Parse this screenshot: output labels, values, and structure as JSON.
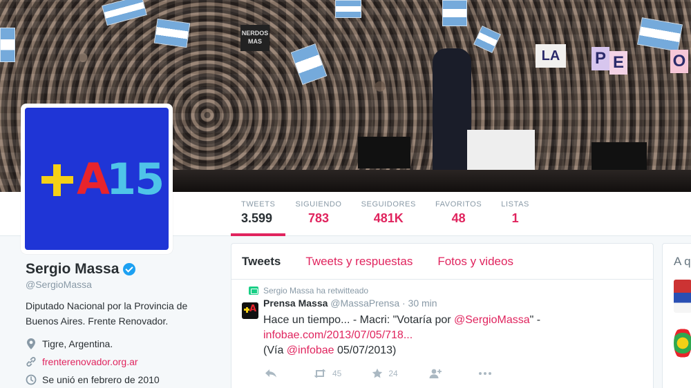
{
  "header": {
    "banner_sign": "NERDOS MAS",
    "banner_letters": [
      "LA",
      "P",
      "E",
      "O"
    ]
  },
  "avatar": {
    "logo_a": "A",
    "logo_15": "15"
  },
  "stats": [
    {
      "label": "TWEETS",
      "value": "3.599"
    },
    {
      "label": "SIGUIENDO",
      "value": "783"
    },
    {
      "label": "SEGUIDORES",
      "value": "481K"
    },
    {
      "label": "FAVORITOS",
      "value": "48"
    },
    {
      "label": "LISTAS",
      "value": "1"
    }
  ],
  "profile": {
    "name": "Sergio Massa",
    "handle": "@SergioMassa",
    "bio": "Diputado Nacional por la Provincia de Buenos Aires. Frente Renovador.",
    "location": "Tigre, Argentina.",
    "website": "frenterenovador.org.ar",
    "joined": "Se unió en febrero de 2010"
  },
  "timeline": {
    "tabs": [
      "Tweets",
      "Tweets y respuestas",
      "Fotos y videos"
    ],
    "tweet": {
      "retweet_note": "Sergio Massa ha retwitteado",
      "author": "Prensa Massa",
      "handle": "@MassaPrensa",
      "time": "· 30 min",
      "text_part1": "Hace un tiempo... - Macri: \"Votaría por ",
      "mention1": "@SergioMassa",
      "text_part2": "\" - ",
      "link": "infobae.com/2013/07/05/718...",
      "text_part3": "(Vía ",
      "mention2": "@infobae",
      "text_part4": " 05/07/2013)",
      "retweets": "45",
      "favorites": "24"
    }
  },
  "right_panel": {
    "title": "A q"
  },
  "colors": {
    "accent": "#e0245e",
    "verified": "#1da1f2",
    "avatar_bg": "#1f35d6"
  }
}
